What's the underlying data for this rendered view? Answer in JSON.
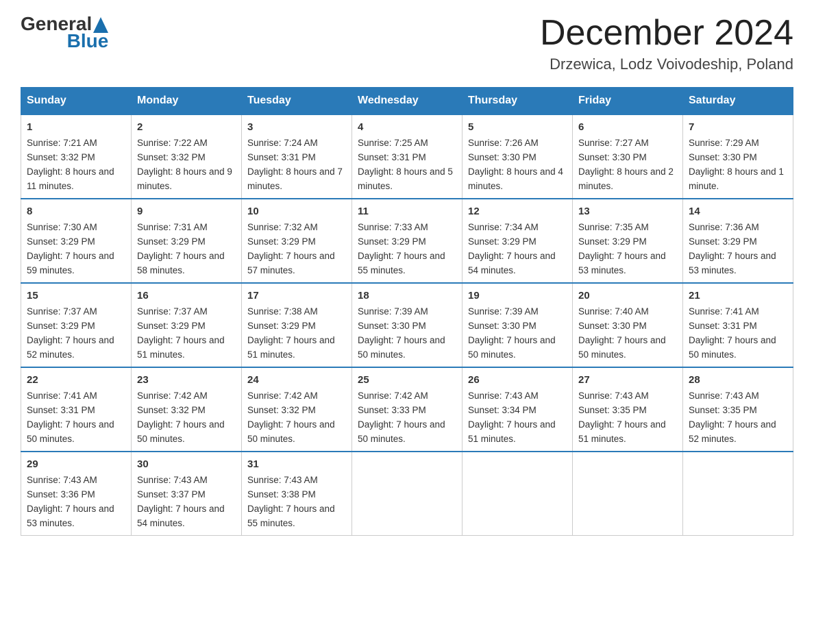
{
  "header": {
    "logo_text_general": "General",
    "logo_text_blue": "Blue",
    "month_title": "December 2024",
    "location": "Drzewica, Lodz Voivodeship, Poland"
  },
  "days_of_week": [
    "Sunday",
    "Monday",
    "Tuesday",
    "Wednesday",
    "Thursday",
    "Friday",
    "Saturday"
  ],
  "weeks": [
    [
      {
        "day": "1",
        "sunrise": "7:21 AM",
        "sunset": "3:32 PM",
        "daylight": "8 hours and 11 minutes."
      },
      {
        "day": "2",
        "sunrise": "7:22 AM",
        "sunset": "3:32 PM",
        "daylight": "8 hours and 9 minutes."
      },
      {
        "day": "3",
        "sunrise": "7:24 AM",
        "sunset": "3:31 PM",
        "daylight": "8 hours and 7 minutes."
      },
      {
        "day": "4",
        "sunrise": "7:25 AM",
        "sunset": "3:31 PM",
        "daylight": "8 hours and 5 minutes."
      },
      {
        "day": "5",
        "sunrise": "7:26 AM",
        "sunset": "3:30 PM",
        "daylight": "8 hours and 4 minutes."
      },
      {
        "day": "6",
        "sunrise": "7:27 AM",
        "sunset": "3:30 PM",
        "daylight": "8 hours and 2 minutes."
      },
      {
        "day": "7",
        "sunrise": "7:29 AM",
        "sunset": "3:30 PM",
        "daylight": "8 hours and 1 minute."
      }
    ],
    [
      {
        "day": "8",
        "sunrise": "7:30 AM",
        "sunset": "3:29 PM",
        "daylight": "7 hours and 59 minutes."
      },
      {
        "day": "9",
        "sunrise": "7:31 AM",
        "sunset": "3:29 PM",
        "daylight": "7 hours and 58 minutes."
      },
      {
        "day": "10",
        "sunrise": "7:32 AM",
        "sunset": "3:29 PM",
        "daylight": "7 hours and 57 minutes."
      },
      {
        "day": "11",
        "sunrise": "7:33 AM",
        "sunset": "3:29 PM",
        "daylight": "7 hours and 55 minutes."
      },
      {
        "day": "12",
        "sunrise": "7:34 AM",
        "sunset": "3:29 PM",
        "daylight": "7 hours and 54 minutes."
      },
      {
        "day": "13",
        "sunrise": "7:35 AM",
        "sunset": "3:29 PM",
        "daylight": "7 hours and 53 minutes."
      },
      {
        "day": "14",
        "sunrise": "7:36 AM",
        "sunset": "3:29 PM",
        "daylight": "7 hours and 53 minutes."
      }
    ],
    [
      {
        "day": "15",
        "sunrise": "7:37 AM",
        "sunset": "3:29 PM",
        "daylight": "7 hours and 52 minutes."
      },
      {
        "day": "16",
        "sunrise": "7:37 AM",
        "sunset": "3:29 PM",
        "daylight": "7 hours and 51 minutes."
      },
      {
        "day": "17",
        "sunrise": "7:38 AM",
        "sunset": "3:29 PM",
        "daylight": "7 hours and 51 minutes."
      },
      {
        "day": "18",
        "sunrise": "7:39 AM",
        "sunset": "3:30 PM",
        "daylight": "7 hours and 50 minutes."
      },
      {
        "day": "19",
        "sunrise": "7:39 AM",
        "sunset": "3:30 PM",
        "daylight": "7 hours and 50 minutes."
      },
      {
        "day": "20",
        "sunrise": "7:40 AM",
        "sunset": "3:30 PM",
        "daylight": "7 hours and 50 minutes."
      },
      {
        "day": "21",
        "sunrise": "7:41 AM",
        "sunset": "3:31 PM",
        "daylight": "7 hours and 50 minutes."
      }
    ],
    [
      {
        "day": "22",
        "sunrise": "7:41 AM",
        "sunset": "3:31 PM",
        "daylight": "7 hours and 50 minutes."
      },
      {
        "day": "23",
        "sunrise": "7:42 AM",
        "sunset": "3:32 PM",
        "daylight": "7 hours and 50 minutes."
      },
      {
        "day": "24",
        "sunrise": "7:42 AM",
        "sunset": "3:32 PM",
        "daylight": "7 hours and 50 minutes."
      },
      {
        "day": "25",
        "sunrise": "7:42 AM",
        "sunset": "3:33 PM",
        "daylight": "7 hours and 50 minutes."
      },
      {
        "day": "26",
        "sunrise": "7:43 AM",
        "sunset": "3:34 PM",
        "daylight": "7 hours and 51 minutes."
      },
      {
        "day": "27",
        "sunrise": "7:43 AM",
        "sunset": "3:35 PM",
        "daylight": "7 hours and 51 minutes."
      },
      {
        "day": "28",
        "sunrise": "7:43 AM",
        "sunset": "3:35 PM",
        "daylight": "7 hours and 52 minutes."
      }
    ],
    [
      {
        "day": "29",
        "sunrise": "7:43 AM",
        "sunset": "3:36 PM",
        "daylight": "7 hours and 53 minutes."
      },
      {
        "day": "30",
        "sunrise": "7:43 AM",
        "sunset": "3:37 PM",
        "daylight": "7 hours and 54 minutes."
      },
      {
        "day": "31",
        "sunrise": "7:43 AM",
        "sunset": "3:38 PM",
        "daylight": "7 hours and 55 minutes."
      },
      null,
      null,
      null,
      null
    ]
  ]
}
